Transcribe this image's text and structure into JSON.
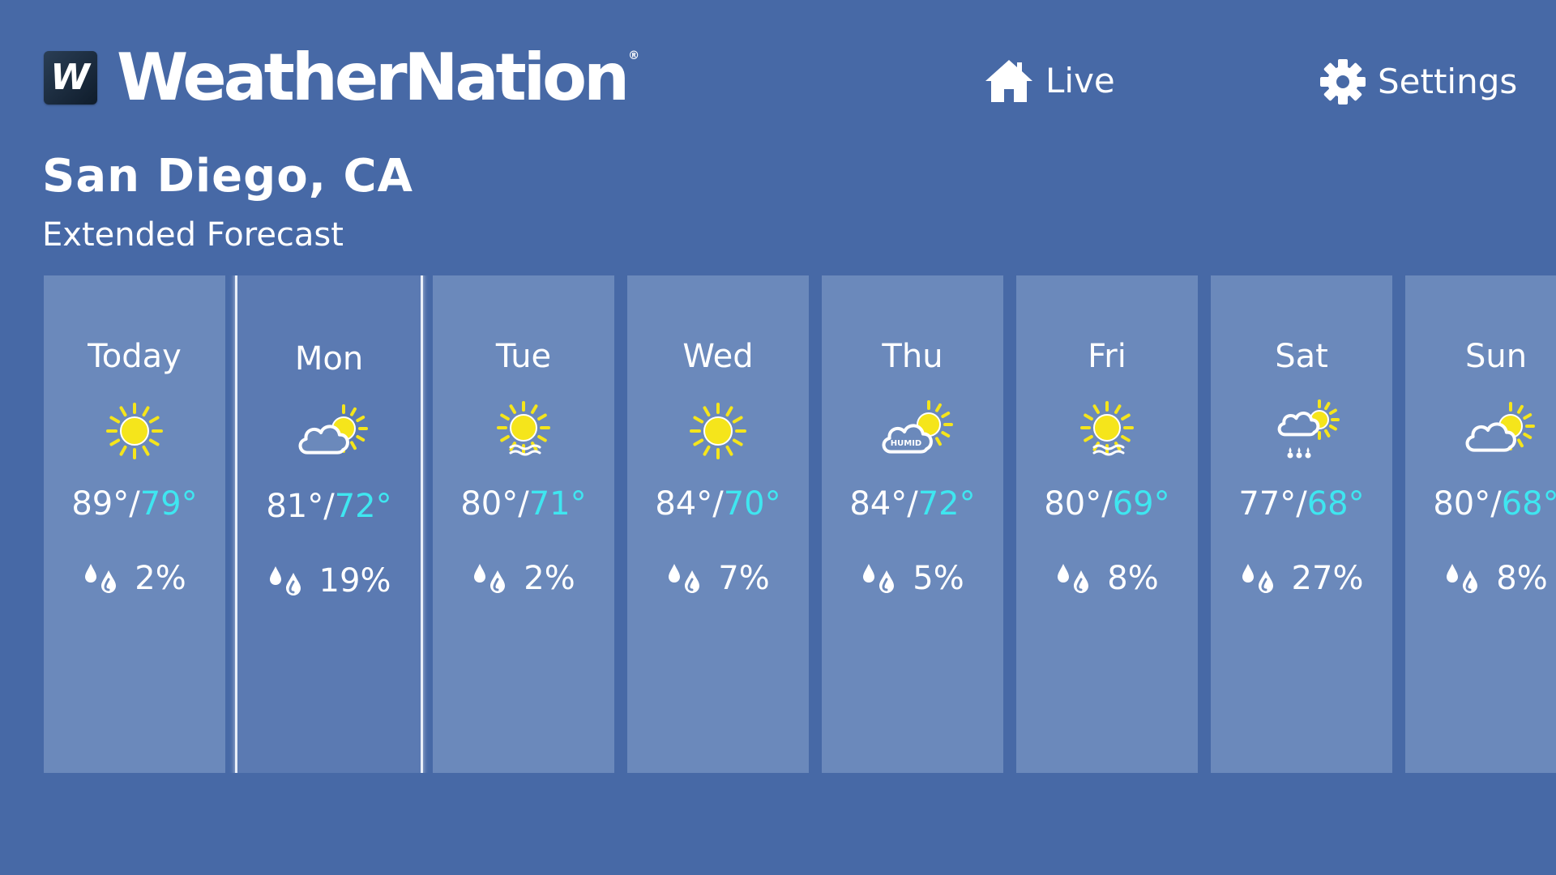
{
  "header": {
    "brand_letter": "W",
    "brand_name": "WeatherNation",
    "brand_reg": "®",
    "nav": {
      "live_label": "Live",
      "settings_label": "Settings"
    }
  },
  "location": {
    "city": "San Diego, CA",
    "subtitle": "Extended Forecast"
  },
  "colors": {
    "background": "#4769a6",
    "card": "#6b89bb",
    "card_selected": "#5b7ab2",
    "low_temp": "#3fe6f0",
    "sun": "#f5e51b"
  },
  "forecast": [
    {
      "day": "Today",
      "icon": "sunny-icon",
      "high": "89°",
      "low": "79°",
      "precip": "2%",
      "selected": false
    },
    {
      "day": "Mon",
      "icon": "partly-cloudy-icon",
      "high": "81°",
      "low": "72°",
      "precip": "19%",
      "selected": true
    },
    {
      "day": "Tue",
      "icon": "sunny-haze-icon",
      "high": "80°",
      "low": "71°",
      "precip": "2%",
      "selected": false
    },
    {
      "day": "Wed",
      "icon": "sunny-icon",
      "high": "84°",
      "low": "70°",
      "precip": "7%",
      "selected": false
    },
    {
      "day": "Thu",
      "icon": "humid-partly-cloudy-icon",
      "high": "84°",
      "low": "72°",
      "precip": "5%",
      "selected": false
    },
    {
      "day": "Fri",
      "icon": "sunny-haze-icon",
      "high": "80°",
      "low": "69°",
      "precip": "8%",
      "selected": false
    },
    {
      "day": "Sat",
      "icon": "sun-showers-icon",
      "high": "77°",
      "low": "68°",
      "precip": "27%",
      "selected": false
    },
    {
      "day": "Sun",
      "icon": "partly-cloudy-icon",
      "high": "80°",
      "low": "68°",
      "precip": "8%",
      "selected": false
    }
  ],
  "humid_label": "HUMID"
}
